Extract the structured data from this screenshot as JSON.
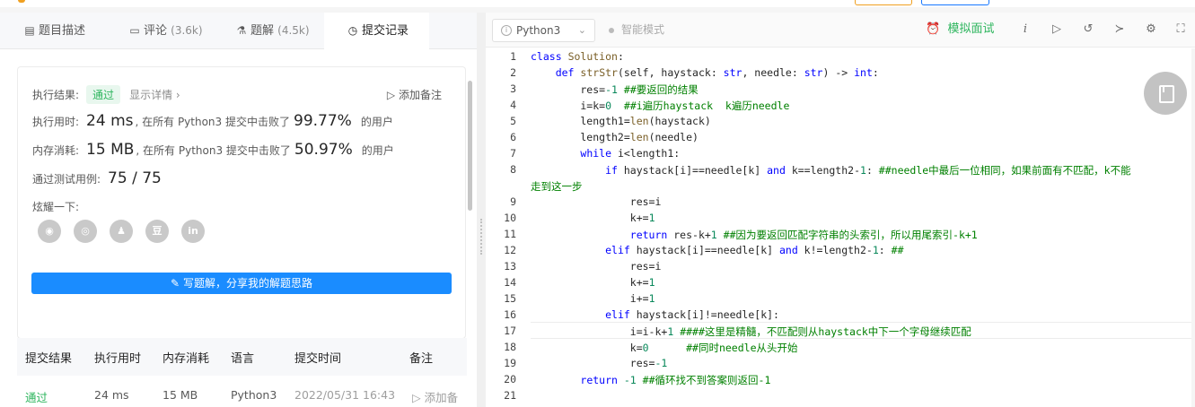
{
  "tabs": [
    {
      "label": "题目描述",
      "count": ""
    },
    {
      "label": "评论",
      "count": "(3.6k)"
    },
    {
      "label": "题解",
      "count": "(4.5k)"
    },
    {
      "label": "提交记录",
      "count": ""
    }
  ],
  "result": {
    "status_label": "执行结果:",
    "status_value": "通过",
    "detail_link": "显示详情 ›",
    "add_note": "添加备注",
    "runtime_label": "执行用时:",
    "runtime_value": "24 ms",
    "runtime_text": ", 在所有 Python3 提交中击败了",
    "runtime_pct": "99.77%",
    "users_suffix": "的用户",
    "memory_label": "内存消耗:",
    "memory_value": "15 MB",
    "memory_text": ", 在所有 Python3 提交中击败了",
    "memory_pct": "50.97%",
    "tests_label": "通过测试用例:",
    "tests_value": "75 / 75",
    "share_label": "炫耀一下:",
    "write_button": "写题解，分享我的解题思路"
  },
  "table": {
    "headers": [
      "提交结果",
      "执行用时",
      "内存消耗",
      "语言",
      "提交时间",
      "备注"
    ],
    "rows": [
      {
        "result": "通过",
        "runtime": "24 ms",
        "memory": "15 MB",
        "language": "Python3",
        "time": "2022/05/31 16:43",
        "note": "添加备"
      }
    ]
  },
  "editor": {
    "language": "Python3",
    "smart_mode": "智能模式",
    "mock_interview": "模拟面试",
    "line_numbers": [
      "1",
      "2",
      "3",
      "4",
      "5",
      "6",
      "7",
      "8",
      "",
      "9",
      "10",
      "11",
      "12",
      "13",
      "14",
      "15",
      "16",
      "17",
      "18",
      "19",
      "20",
      "21"
    ]
  },
  "colors": {
    "accent": "#1a8cff",
    "success": "#2db55d",
    "keyword": "#0000ff",
    "comment": "#008000"
  }
}
